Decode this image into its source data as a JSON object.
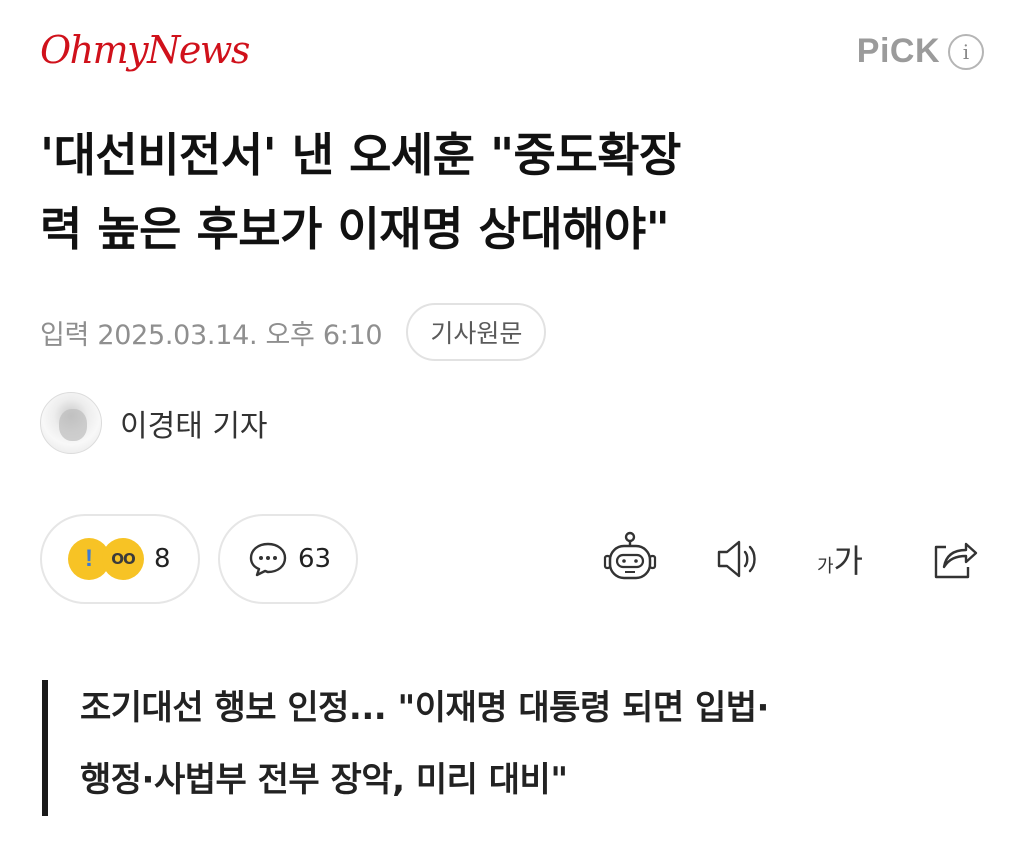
{
  "header": {
    "logo_text": "OhmyNews",
    "pick_label": "PiCK",
    "info_icon_label": "i",
    "logo_color": "#d0111b"
  },
  "article": {
    "headline_line1": "'대선비전서' 낸 오세훈 \"중도확장",
    "headline_line2": "력 높은 후보가 이재명 상대해야\"",
    "date": "입력 2025.03.14. 오후 6:10",
    "source_button": "기사원문",
    "author": "이경태 기자",
    "subheadline_line1": "조기대선 행보 인정... \"이재명 대통령 되면 입법·",
    "subheadline_line2": "행정·사법부 전부 장악, 미리 대비\""
  },
  "actions": {
    "reaction_count": "8",
    "comment_count": "63",
    "font_small": "가",
    "font_large": "가",
    "icons": [
      "surprised-emoji-icon",
      "amazed-emoji-icon",
      "comment-icon",
      "robot-summary-icon",
      "speaker-icon",
      "font-size-icon",
      "share-icon"
    ]
  }
}
